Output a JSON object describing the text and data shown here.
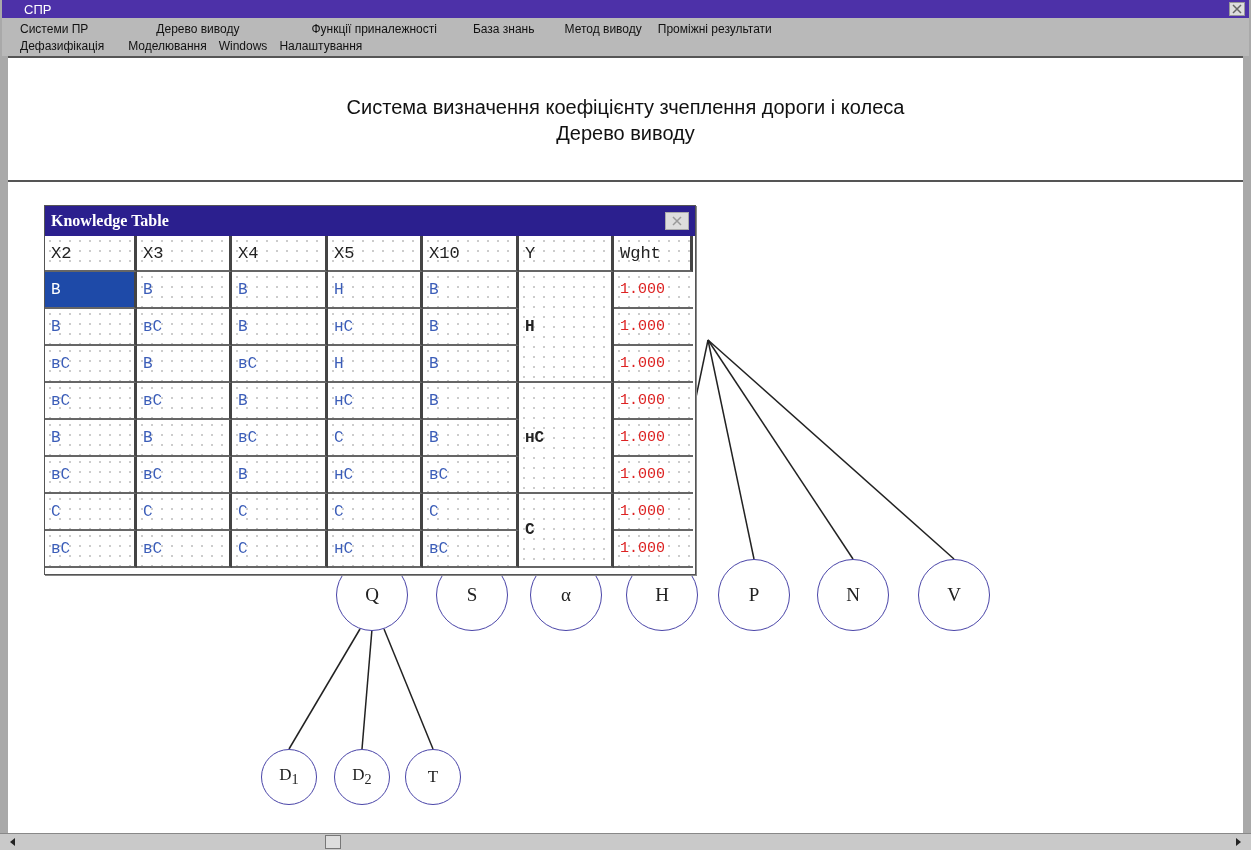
{
  "window": {
    "title": "СПР"
  },
  "menu_rows": [
    {
      "items": [
        "Системи ПР",
        "Дерево виводу",
        "Функції приналежності",
        "База знань",
        "Метод виводу",
        "Проміжні результати"
      ]
    },
    {
      "items": [
        "Дефазифікація",
        "Моделювання",
        "Windows",
        "Налаштування"
      ]
    }
  ],
  "header": {
    "title": "Система визначення коефіцієнту зчеплення дороги і колеса",
    "subtitle": "Дерево виводу"
  },
  "tree": {
    "nodes": [
      {
        "label": "Q",
        "children": [
          {
            "label": "D$_{1}$"
          },
          {
            "label": "D$_{2}$"
          },
          {
            "label": "T"
          }
        ]
      },
      {
        "label": "S"
      },
      {
        "label": "α"
      },
      {
        "label": "H"
      },
      {
        "label": "P"
      },
      {
        "label": "N"
      },
      {
        "label": "V"
      }
    ]
  },
  "knowledge_table": {
    "title": "Knowledge Table",
    "columns": [
      "X2",
      "X3",
      "X4",
      "X5",
      "X10",
      "Y",
      "Wght"
    ],
    "groups": [
      {
        "y": "Н",
        "rows": [
          {
            "cells": [
              "В",
              "В",
              "В",
              "Н",
              "В"
            ],
            "selected": true,
            "weight": "1.000"
          },
          {
            "cells": [
              "В",
              "вС",
              "В",
              "нС",
              "В"
            ],
            "selected": false,
            "weight": "1.000"
          },
          {
            "cells": [
              "вС",
              "В",
              "вС",
              "Н",
              "В"
            ],
            "selected": false,
            "weight": "1.000"
          }
        ]
      },
      {
        "y": "нС",
        "rows": [
          {
            "cells": [
              "вС",
              "вС",
              "В",
              "нС",
              "В"
            ],
            "selected": false,
            "weight": "1.000"
          },
          {
            "cells": [
              "В",
              "В",
              "вС",
              "С",
              "В"
            ],
            "selected": false,
            "weight": "1.000"
          },
          {
            "cells": [
              "вС",
              "вС",
              "В",
              "нС",
              "вС"
            ],
            "selected": false,
            "weight": "1.000"
          }
        ]
      },
      {
        "y": "С",
        "rows": [
          {
            "cells": [
              "С",
              "С",
              "С",
              "С",
              "С"
            ],
            "selected": false,
            "weight": "1.000"
          },
          {
            "cells": [
              "вС",
              "вС",
              "С",
              "нС",
              "вС"
            ],
            "selected": false,
            "weight": "1.000"
          }
        ]
      }
    ]
  }
}
